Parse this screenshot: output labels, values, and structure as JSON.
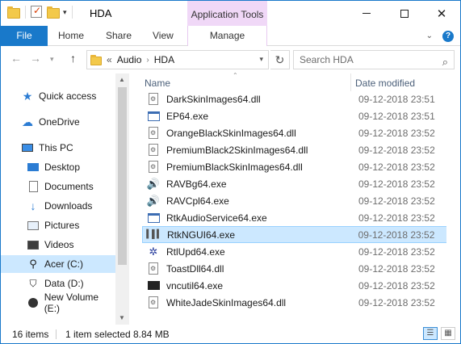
{
  "window": {
    "title": "HDA",
    "context_tab_group": "Application Tools"
  },
  "ribbon": {
    "tabs": [
      {
        "label": "File"
      },
      {
        "label": "Home"
      },
      {
        "label": "Share"
      },
      {
        "label": "View"
      },
      {
        "label": "Manage"
      }
    ]
  },
  "address": {
    "prefix": "«",
    "crumbs": [
      "Audio",
      "HDA"
    ],
    "search_placeholder": "Search HDA"
  },
  "nav": {
    "items": [
      {
        "label": "Quick access",
        "icon": "star-icon"
      },
      {
        "label": "OneDrive",
        "icon": "cloud-icon"
      },
      {
        "label": "This PC",
        "icon": "computer-icon"
      },
      {
        "label": "Desktop",
        "icon": "desktop-icon"
      },
      {
        "label": "Documents",
        "icon": "documents-icon"
      },
      {
        "label": "Downloads",
        "icon": "download-icon"
      },
      {
        "label": "Pictures",
        "icon": "pictures-icon"
      },
      {
        "label": "Videos",
        "icon": "videos-icon"
      },
      {
        "label": "Acer (C:)",
        "icon": "drive-icon",
        "selected": true
      },
      {
        "label": "Data (D:)",
        "icon": "drive-icon"
      },
      {
        "label": "New Volume (E:)",
        "icon": "drive-icon"
      }
    ]
  },
  "filelist": {
    "columns": {
      "name": "Name",
      "date": "Date modified"
    },
    "rows": [
      {
        "name": "DarkSkinImages64.dll",
        "date": "09-12-2018 23:51",
        "type": "dll"
      },
      {
        "name": "EP64.exe",
        "date": "09-12-2018 23:51",
        "type": "exe"
      },
      {
        "name": "OrangeBlackSkinImages64.dll",
        "date": "09-12-2018 23:52",
        "type": "dll"
      },
      {
        "name": "PremiumBlack2SkinImages64.dll",
        "date": "09-12-2018 23:52",
        "type": "dll"
      },
      {
        "name": "PremiumBlackSkinImages64.dll",
        "date": "09-12-2018 23:52",
        "type": "dll"
      },
      {
        "name": "RAVBg64.exe",
        "date": "09-12-2018 23:52",
        "type": "speaker"
      },
      {
        "name": "RAVCpl64.exe",
        "date": "09-12-2018 23:52",
        "type": "speaker"
      },
      {
        "name": "RtkAudioService64.exe",
        "date": "09-12-2018 23:52",
        "type": "exe"
      },
      {
        "name": "RtkNGUI64.exe",
        "date": "09-12-2018 23:52",
        "type": "audio",
        "selected": true
      },
      {
        "name": "RtlUpd64.exe",
        "date": "09-12-2018 23:52",
        "type": "upd"
      },
      {
        "name": "ToastDll64.dll",
        "date": "09-12-2018 23:52",
        "type": "dll"
      },
      {
        "name": "vncutil64.exe",
        "date": "09-12-2018 23:52",
        "type": "vnc"
      },
      {
        "name": "WhiteJadeSkinImages64.dll",
        "date": "09-12-2018 23:52",
        "type": "dll"
      }
    ]
  },
  "status": {
    "item_count": "16 items",
    "selection": "1 item selected",
    "size": "8.84 MB"
  },
  "colors": {
    "accent": "#1979ca",
    "context_tab": "#f0d8f7",
    "selection": "#cce8ff"
  }
}
